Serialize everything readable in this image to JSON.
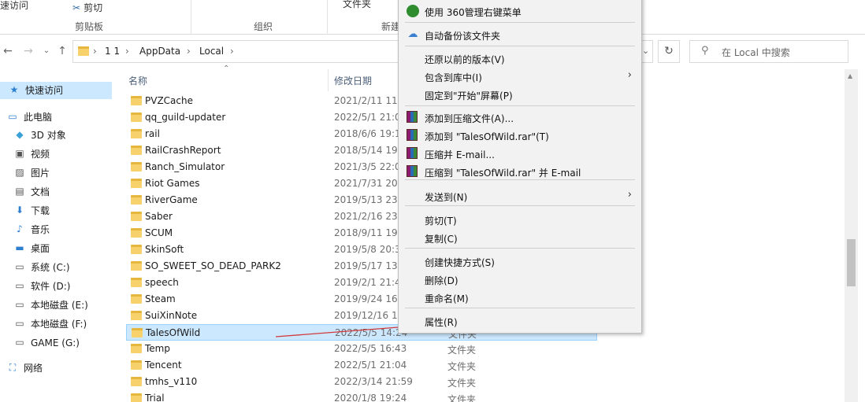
{
  "ribbon": {
    "quick_access": "速访问",
    "cut": "剪切",
    "clipboard": "剪贴板",
    "organize": "组织",
    "new_folder": "文件夹",
    "new": "新建"
  },
  "address": {
    "crumbs": [
      "1 1",
      "AppData",
      "Local"
    ],
    "search_placeholder": "在 Local 中搜索"
  },
  "nav": [
    {
      "label": "快速访问",
      "icon": "star-icon",
      "selected": true
    },
    {
      "label": "此电脑",
      "icon": "computer-icon"
    },
    {
      "label": "3D 对象",
      "icon": "3d-objects-icon"
    },
    {
      "label": "视频",
      "icon": "video-icon"
    },
    {
      "label": "图片",
      "icon": "pictures-icon"
    },
    {
      "label": "文档",
      "icon": "documents-icon"
    },
    {
      "label": "下载",
      "icon": "download-icon"
    },
    {
      "label": "音乐",
      "icon": "music-icon"
    },
    {
      "label": "桌面",
      "icon": "desktop-icon"
    },
    {
      "label": "系统 (C:)",
      "icon": "drive-icon"
    },
    {
      "label": "软件 (D:)",
      "icon": "drive-icon"
    },
    {
      "label": "本地磁盘 (E:)",
      "icon": "drive-icon"
    },
    {
      "label": "本地磁盘 (F:)",
      "icon": "drive-icon"
    },
    {
      "label": "GAME (G:)",
      "icon": "drive-icon"
    },
    {
      "label": "网络",
      "icon": "network-icon"
    }
  ],
  "columns": {
    "name": "名称",
    "date": "修改日期"
  },
  "files": [
    {
      "name": "PVZCache",
      "date": "2021/2/11 11:",
      "type": ""
    },
    {
      "name": "qq_guild-updater",
      "date": "2022/5/1 21:0",
      "type": ""
    },
    {
      "name": "rail",
      "date": "2018/6/6 19:1",
      "type": ""
    },
    {
      "name": "RailCrashReport",
      "date": "2018/5/14 19:",
      "type": ""
    },
    {
      "name": "Ranch_Simulator",
      "date": "2021/3/5 22:0",
      "type": ""
    },
    {
      "name": "Riot Games",
      "date": "2021/7/31 20:",
      "type": ""
    },
    {
      "name": "RiverGame",
      "date": "2019/5/13 23:",
      "type": ""
    },
    {
      "name": "Saber",
      "date": "2021/2/16 23:",
      "type": ""
    },
    {
      "name": "SCUM",
      "date": "2018/9/11 19:",
      "type": ""
    },
    {
      "name": "SkinSoft",
      "date": "2019/5/8 20:3",
      "type": ""
    },
    {
      "name": "SO_SWEET_SO_DEAD_PARK2",
      "date": "2019/5/17 13:",
      "type": ""
    },
    {
      "name": "speech",
      "date": "2019/2/1 21:4",
      "type": ""
    },
    {
      "name": "Steam",
      "date": "2019/9/24 16:",
      "type": ""
    },
    {
      "name": "SuiXinNote",
      "date": "2019/12/16 12",
      "type": ""
    },
    {
      "name": "TalesOfWild",
      "date": "2022/5/5 14:24",
      "type": "文件夹",
      "selected": true
    },
    {
      "name": "Temp",
      "date": "2022/5/5 16:43",
      "type": "文件夹"
    },
    {
      "name": "Tencent",
      "date": "2022/5/1 21:04",
      "type": "文件夹"
    },
    {
      "name": "tmhs_v110",
      "date": "2022/3/14 21:59",
      "type": "文件夹"
    },
    {
      "name": "Trial",
      "date": "2020/1/8 19:24",
      "type": "文件夹"
    }
  ],
  "context_menu": [
    {
      "label": "使用 360管理右键菜单",
      "icon": "360-icon"
    },
    {
      "sep": true
    },
    {
      "label": "自动备份该文件夹",
      "icon": "cloud-backup-icon"
    },
    {
      "sep": true
    },
    {
      "label": "还原以前的版本(V)"
    },
    {
      "label": "包含到库中(I)",
      "submenu": true
    },
    {
      "label": "固定到\"开始\"屏幕(P)"
    },
    {
      "sep": true
    },
    {
      "label": "添加到压缩文件(A)...",
      "icon": "winrar-icon"
    },
    {
      "label": "添加到 \"TalesOfWild.rar\"(T)",
      "icon": "winrar-icon"
    },
    {
      "label": "压缩并 E-mail...",
      "icon": "winrar-icon"
    },
    {
      "label": "压缩到 \"TalesOfWild.rar\" 并 E-mail",
      "icon": "winrar-icon"
    },
    {
      "sep": true
    },
    {
      "label": "发送到(N)",
      "submenu": true
    },
    {
      "sep": true
    },
    {
      "label": "剪切(T)"
    },
    {
      "label": "复制(C)"
    },
    {
      "sep": true
    },
    {
      "label": "创建快捷方式(S)"
    },
    {
      "label": "删除(D)"
    },
    {
      "label": "重命名(M)"
    },
    {
      "sep": true
    },
    {
      "label": "属性(R)"
    }
  ],
  "colors": {
    "selection": "#cce8ff",
    "selection_border": "#99d1ff",
    "annotation_arrow": "#d23a3a"
  }
}
